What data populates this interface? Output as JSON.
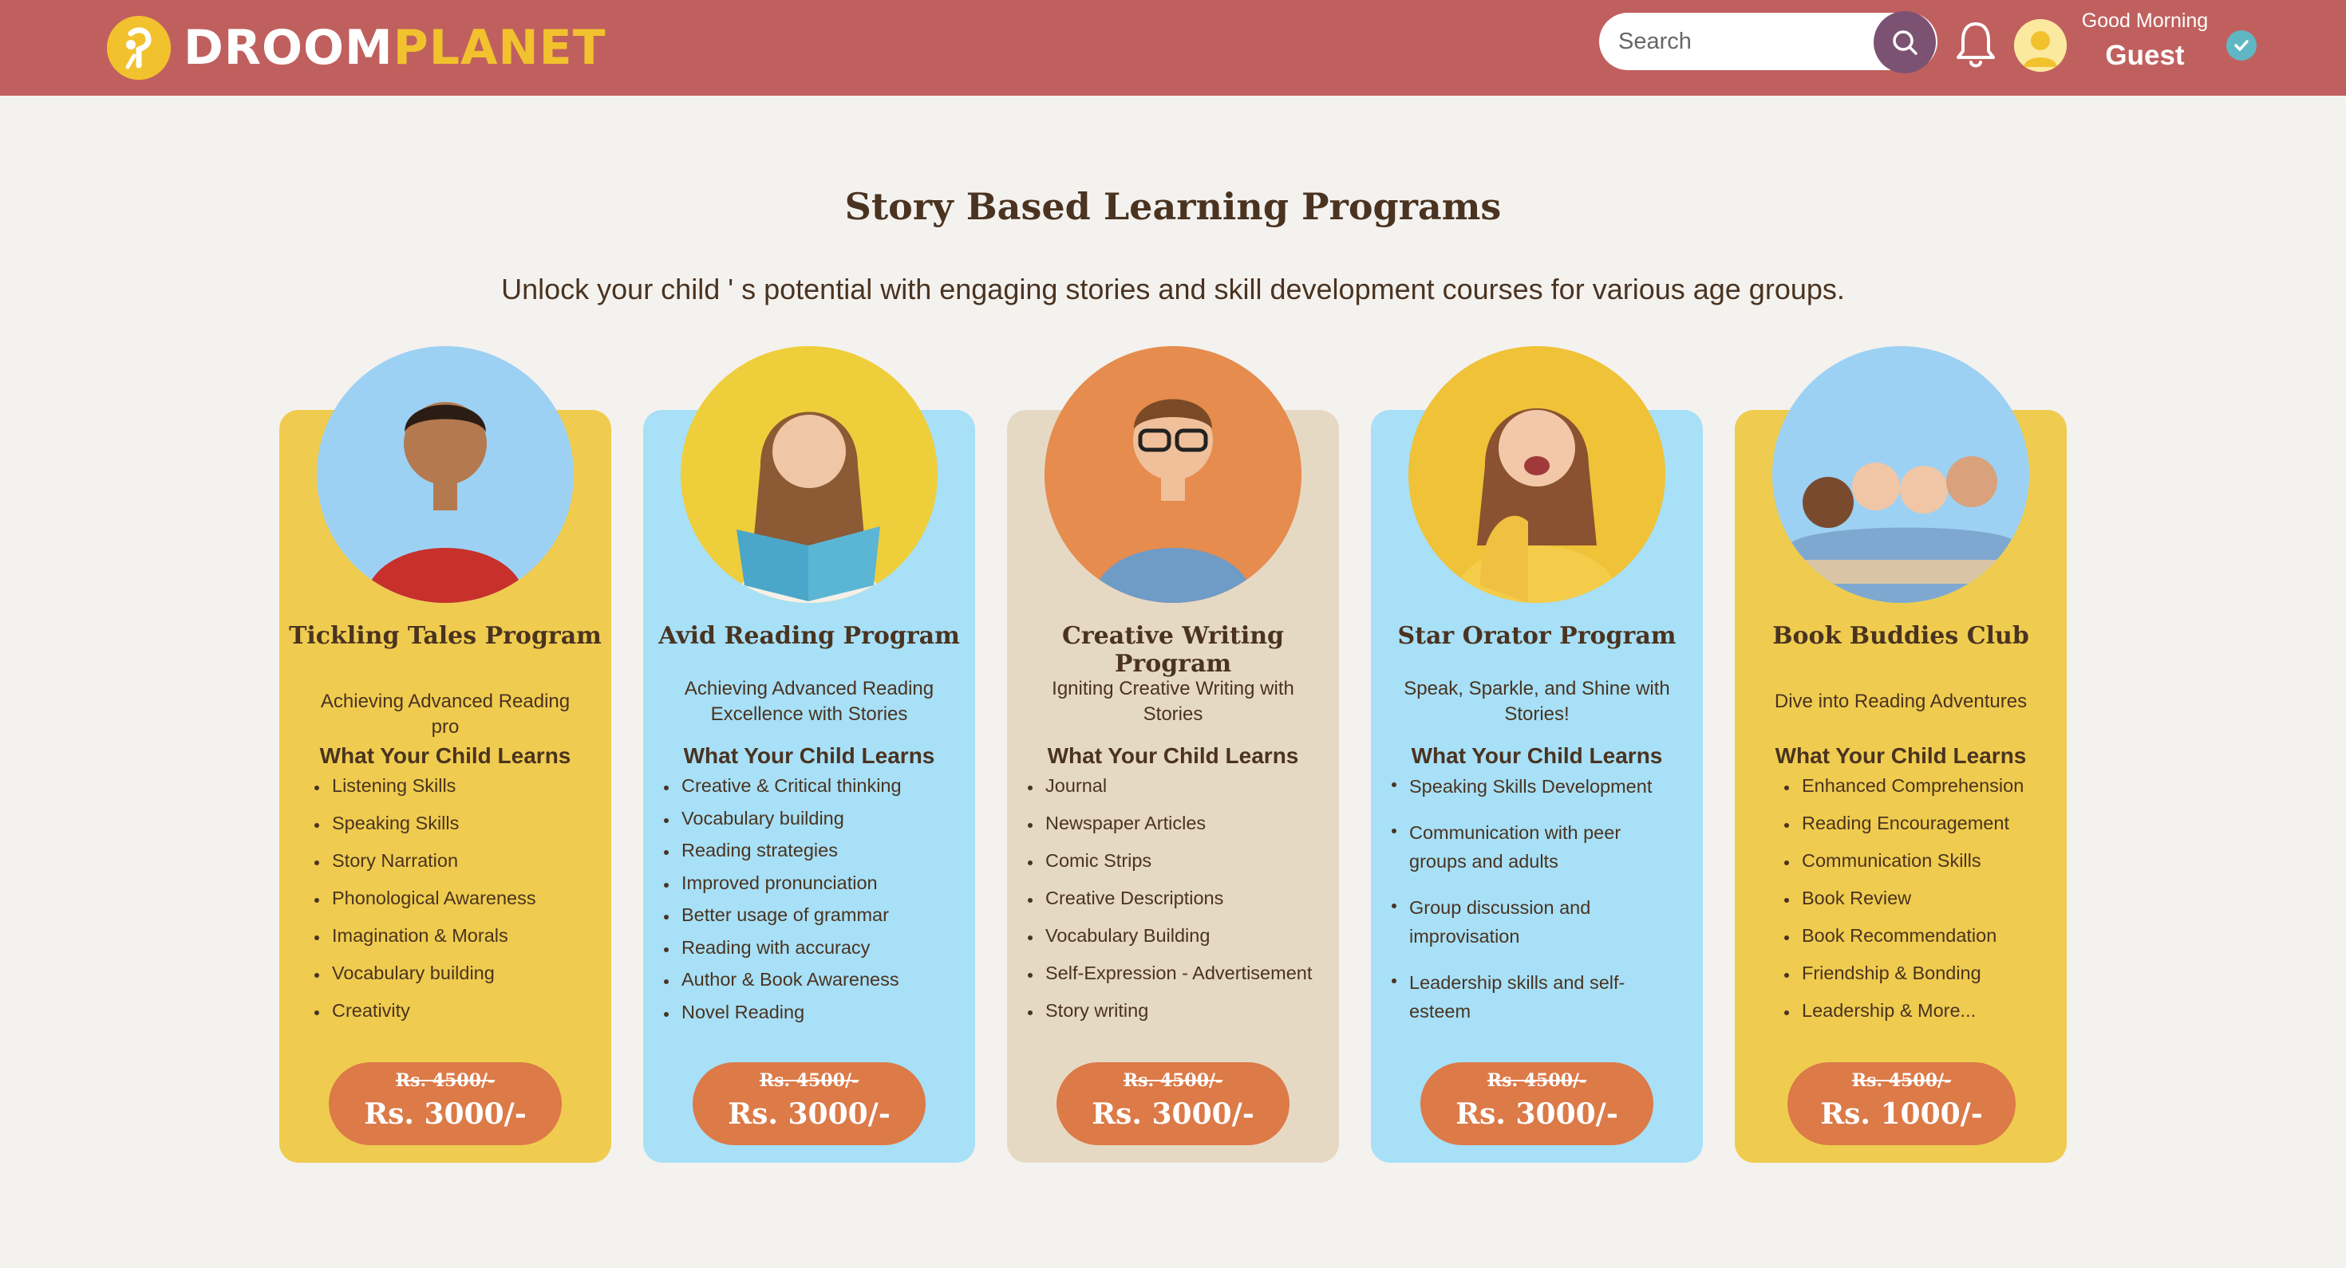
{
  "brand": {
    "name_part1": "DROOM",
    "name_part2": "PLANET"
  },
  "header": {
    "search_placeholder": "Search",
    "greeting": "Good Morning",
    "user_name": "Guest"
  },
  "page": {
    "title": "Story Based Learning Programs",
    "subtitle": "Unlock your child ' s potential with engaging stories and skill development courses for various age groups."
  },
  "colors": {
    "header_bg": "#c0605e",
    "brand_yellow": "#f2c22e",
    "card_yellow": "#efcc4f",
    "card_blue": "#a7e0f7",
    "card_beige": "#e6d9c4",
    "price_orange": "#dc7a48"
  },
  "programs": [
    {
      "title": "Tickling Tales Program",
      "tagline": "Achieving Advanced Reading pro",
      "learns_heading": "What Your Child Learns",
      "skills": [
        "Listening Skills",
        "Speaking Skills",
        "Story Narration",
        "Phonological Awareness",
        "Imagination & Morals",
        "Vocabulary building",
        "Creativity"
      ],
      "old_price": "Rs. 4500/-",
      "price": "Rs. 3000/-"
    },
    {
      "title": "Avid Reading Program",
      "tagline": "Achieving Advanced Reading Excellence with Stories",
      "learns_heading": "What Your Child Learns",
      "skills": [
        "Creative & Critical thinking",
        "Vocabulary building",
        "Reading strategies",
        "Improved pronunciation",
        "Better usage of grammar",
        "Reading with accuracy",
        "Author & Book Awareness",
        "Novel Reading"
      ],
      "old_price": "Rs. 4500/-",
      "price": "Rs. 3000/-"
    },
    {
      "title": "Creative Writing Program",
      "tagline": "Igniting Creative Writing with Stories",
      "learns_heading": "What Your Child Learns",
      "skills": [
        "Journal",
        "Newspaper Articles",
        "Comic Strips",
        "Creative Descriptions",
        "Vocabulary Building",
        "Self-Expression - Advertisement",
        "Story writing"
      ],
      "old_price": "Rs. 4500/-",
      "price": "Rs. 3000/-"
    },
    {
      "title": "Star Orator Program",
      "tagline": "Speak, Sparkle, and Shine with Stories!",
      "learns_heading": "What Your Child Learns",
      "skills": [
        "Speaking Skills Development",
        "Communication with peer groups and adults",
        "Group discussion and improvisation",
        "Leadership skills and self-esteem"
      ],
      "old_price": "Rs. 4500/-",
      "price": "Rs. 3000/-"
    },
    {
      "title": "Book Buddies Club",
      "tagline": "Dive into Reading Adventures",
      "learns_heading": "What Your Child Learns",
      "skills": [
        "Enhanced Comprehension",
        "Reading Encouragement",
        "Communication Skills",
        "Book Review",
        "Book Recommendation",
        "Friendship & Bonding",
        "Leadership & More..."
      ],
      "old_price": "Rs. 4500/-",
      "price": "Rs. 1000/-"
    }
  ]
}
